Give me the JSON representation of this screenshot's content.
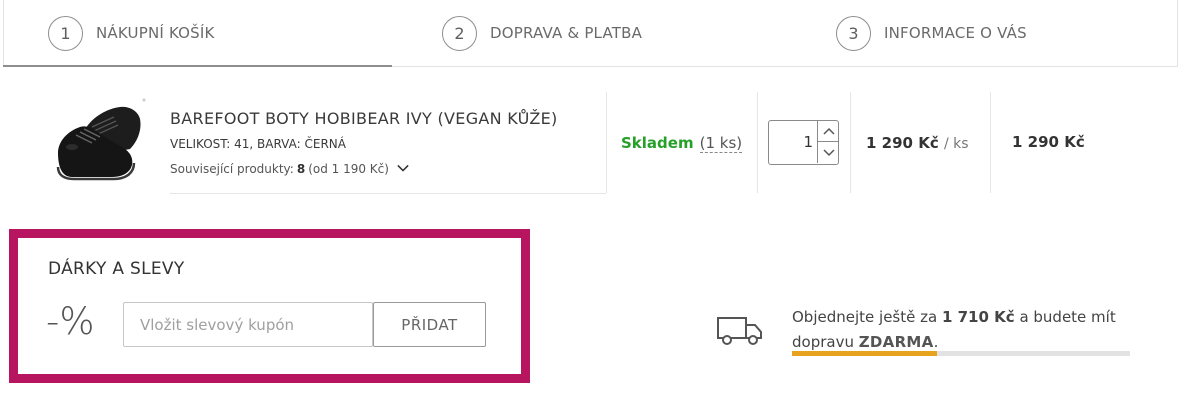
{
  "steps": [
    {
      "number": "1",
      "label": "NÁKUPNÍ KOŠÍK"
    },
    {
      "number": "2",
      "label": "DOPRAVA & PLATBA"
    },
    {
      "number": "3",
      "label": "INFORMACE O VÁS"
    }
  ],
  "product": {
    "name": "BAREFOOT BOTY HOBIBEAR IVY (VEGAN KŮŽE)",
    "variant": "VELIKOST: 41, BARVA: ČERNÁ",
    "related_prefix": "Související produkty:",
    "related_count": "8",
    "related_suffix": "(od 1 190 Kč)",
    "image_icon": "black-barefoot-shoe",
    "stock": "Skladem",
    "stock_qty": "(1 ks)",
    "quantity": "1",
    "unit_price": "1 290 Kč",
    "per_unit": "/ ks",
    "total_price": "1 290 Kč"
  },
  "coupon": {
    "title": "DÁRKY A SLEVY",
    "percent_symbol": "-%",
    "placeholder": "Vložit slevový kupón",
    "button_label": "PŘIDAT"
  },
  "shipping": {
    "text_before": "Objednejte ještě za ",
    "amount": "1 710 Kč",
    "text_middle": " a budete mít dopravu ",
    "free_label": "ZDARMA",
    "text_after": ".",
    "progress_percent": 43
  },
  "colors": {
    "accent_border": "#b7155f",
    "stock_green": "#27a02a",
    "progress_orange": "#e7a21e"
  }
}
